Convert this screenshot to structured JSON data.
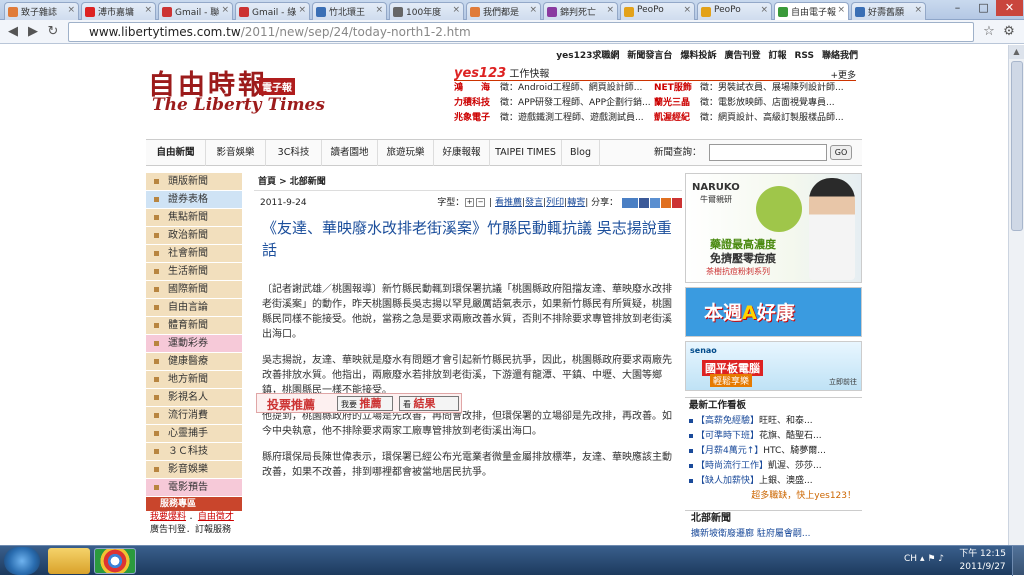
{
  "browser": {
    "tabs": [
      {
        "label": "致子雜誌",
        "color": "#e07b39"
      },
      {
        "label": "溥市嘉墉",
        "color": "#d22"
      },
      {
        "label": "Gmail - 聯",
        "color": "#c33"
      },
      {
        "label": "Gmail - 綠",
        "color": "#c33"
      },
      {
        "label": "竹北環王",
        "color": "#3a6fb5"
      },
      {
        "label": "100年度",
        "color": "#666"
      },
      {
        "label": "我們都是",
        "color": "#e07b39"
      },
      {
        "label": "錦判死亡",
        "color": "#8a3aa0"
      },
      {
        "label": "PeoPo",
        "color": "#e3a21a"
      },
      {
        "label": "PeoPo",
        "color": "#e3a21a"
      },
      {
        "label": "自由電子報",
        "color": "#3a9a3a"
      },
      {
        "label": "好壽舊願",
        "color": "#3a6fb5"
      }
    ],
    "url_host": "www.libertytimes.com.tw",
    "url_path": "/2011/new/sep/24/today-north1-2.htm"
  },
  "site": {
    "logo_cn": "自由時報",
    "logo_badge": "電子報",
    "logo_en": "The Liberty Times",
    "toplinks": [
      "yes123求職網",
      "新聞發言台",
      "爆料投訴",
      "廣告刊登",
      "訂報",
      "RSS",
      "聯絡我們"
    ],
    "jobs_brand": "yes123",
    "jobs_label": "工作快報",
    "jobs_more": "+更多",
    "jobs": [
      [
        "鴻　　海",
        "徵：Android工程師、網頁設計師...",
        "NET服飾",
        "徵：男裝試衣員、展場陳列設計師..."
      ],
      [
        "力積科技",
        "徵：APP研發工程師、APP企劃行銷...",
        "蘭光三晶",
        "徵：電影放映師、店面視覺專員..."
      ],
      [
        "兆象電子",
        "徵：遊戲鐵測工程師、遊戲測試員...",
        "凱渥經紀",
        "徵：網頁設計、高級訂製服樣品師..."
      ]
    ],
    "nav": [
      "自由新聞",
      "影音娛樂",
      "3C科技",
      "讀者園地",
      "旅遊玩樂",
      "好康報報",
      "TAIPEI TIMES",
      "Blog"
    ],
    "search_label": "新聞查詢：",
    "search_btn": "GO"
  },
  "leftnav": [
    {
      "label": "頭版新聞",
      "style": ""
    },
    {
      "label": "證券表格",
      "style": "blue"
    },
    {
      "label": "焦點新聞",
      "style": ""
    },
    {
      "label": "政治新聞",
      "style": ""
    },
    {
      "label": "社會新聞",
      "style": ""
    },
    {
      "label": "生活新聞",
      "style": ""
    },
    {
      "label": "國際新聞",
      "style": ""
    },
    {
      "label": "自由言論",
      "style": ""
    },
    {
      "label": "體育新聞",
      "style": ""
    },
    {
      "label": "運動彩券",
      "style": "pink"
    },
    {
      "label": "健康醫療",
      "style": ""
    },
    {
      "label": "地方新聞",
      "style": ""
    },
    {
      "label": "影視名人",
      "style": ""
    },
    {
      "label": "流行消費",
      "style": ""
    },
    {
      "label": "心靈捕手",
      "style": ""
    },
    {
      "label": "３Ｃ科技",
      "style": ""
    },
    {
      "label": "影音娛樂",
      "style": ""
    },
    {
      "label": "電影預告",
      "style": "pink"
    }
  ],
  "services": {
    "head": "服務專區",
    "row1a": "我要爆料",
    "row1b": "自由徵才",
    "row2": "廣告刊登．訂報服務"
  },
  "article": {
    "breadcrumb": "首頁 > 北部新聞",
    "date": "2011-9-24",
    "font_label": "字型：",
    "tools": [
      "看推薦",
      "發言",
      "列印",
      "轉寄"
    ],
    "share": "分享：",
    "title": "《友達、華映廢水改排老街溪案》竹縣民動輒抗議 吳志揚說重話",
    "paragraphs": [
      "〔記者謝武雄／桃園報導〕新竹縣民動輒到環保署抗議「桃園縣政府阻擋友達、華映廢水改排老街溪案」的動作，昨天桃園縣長吳志揚以罕見嚴厲語氣表示，如果新竹縣民有所質疑，桃園縣民同樣不能接受。他說，當務之急是要求兩廠改善水質，否則不排除要求專管排放到老街溪出海口。",
      "吳志揚說，友達、華映就是廢水有問題才會引起新竹縣民抗爭，因此，桃園縣政府要求兩廠先改善排放水質。他指出，兩廠廢水若排放到老街溪，下游還有龍潭、平鎮、中壢、大園等鄉鎮，桃園縣民一樣不能接受。",
      "他提到，桃園縣政府的立場是先改善，再問會改排，但環保署的立場卻是先改排，再改善。如今中央執意，他不排除要求兩家工廠專管排放到老街溪出海口。",
      "縣府環保局長陳世偉表示，環保署已經公布光電業者微量金屬排放標準，友達、華映應該主動改善，如果不改善，排到哪裡都會被當地居民抗爭。"
    ],
    "vote_label": "投票推薦",
    "vote_btn1_small": "我要",
    "vote_btn1": "推薦",
    "vote_btn2_small": "看",
    "vote_btn2": "結果"
  },
  "ads": {
    "ad1_brand": "NARUKO",
    "ad1_sub": "牛爾親研",
    "ad1_line1": "藥證最高濃度",
    "ad1_line2": "免擠壓零痘痕",
    "ad1_line3": "茶樹抗痘粉刺系列",
    "ad2_pre": "本週",
    "ad2_a": "A",
    "ad2_post": "好康",
    "ad3_brand": "senao",
    "ad3_line1": "國平板電腦",
    "ad3_line2": "輕鬆享樂",
    "ad3_note": "立即前往"
  },
  "jobbox": {
    "head": "最新工作看板",
    "items": [
      {
        "tag": "【高薪免經驗】",
        "text": "旺旺、和泰..."
      },
      {
        "tag": "【可準時下班】",
        "text": "花旗、酷聖石..."
      },
      {
        "tag": "【月薪4萬元↑】",
        "text": "HTC、騎夢爾..."
      },
      {
        "tag": "【時尚流行工作】",
        "text": "凱渥、莎莎..."
      },
      {
        "tag": "【缺人加薪快】",
        "text": "上銀、澳盛..."
      }
    ],
    "more": "超多職缺，快上yes123！"
  },
  "north": {
    "head": "北部新聞",
    "item": "擴新坡衛廢遷廊 駐府屬會嗣..."
  },
  "taskbar": {
    "tray_text": "CH",
    "time": "下午 12:15",
    "date": "2011/9/27"
  }
}
